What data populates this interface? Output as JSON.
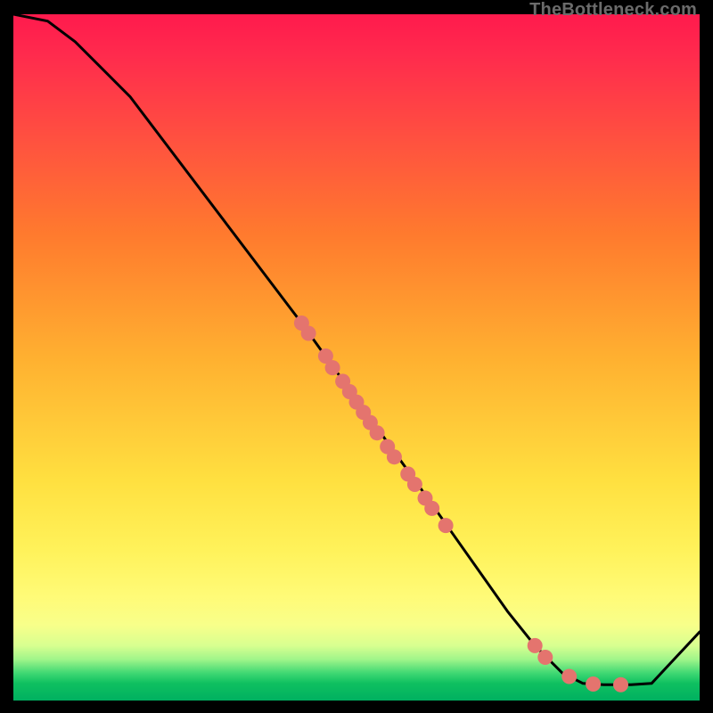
{
  "watermark": "TheBottleneck.com",
  "chart_data": {
    "type": "line",
    "title": "",
    "xlabel": "",
    "ylabel": "",
    "xlim": [
      0,
      100
    ],
    "ylim": [
      0,
      100
    ],
    "grid": false,
    "legend": false,
    "curve": [
      {
        "x": 0,
        "y": 100
      },
      {
        "x": 5,
        "y": 99
      },
      {
        "x": 9,
        "y": 96
      },
      {
        "x": 13,
        "y": 92
      },
      {
        "x": 17,
        "y": 88
      },
      {
        "x": 42,
        "y": 55
      },
      {
        "x": 60,
        "y": 30
      },
      {
        "x": 72,
        "y": 13
      },
      {
        "x": 76,
        "y": 8
      },
      {
        "x": 80,
        "y": 4
      },
      {
        "x": 83,
        "y": 2.5
      },
      {
        "x": 86,
        "y": 2.3
      },
      {
        "x": 90,
        "y": 2.3
      },
      {
        "x": 93,
        "y": 2.5
      },
      {
        "x": 100,
        "y": 10
      }
    ],
    "points": [
      {
        "x": 42,
        "y": 55
      },
      {
        "x": 43,
        "y": 53.5
      },
      {
        "x": 45.5,
        "y": 50.2
      },
      {
        "x": 46.5,
        "y": 48.5
      },
      {
        "x": 48,
        "y": 46.5
      },
      {
        "x": 49,
        "y": 45
      },
      {
        "x": 50,
        "y": 43.5
      },
      {
        "x": 51,
        "y": 42
      },
      {
        "x": 52,
        "y": 40.5
      },
      {
        "x": 53,
        "y": 39
      },
      {
        "x": 54.5,
        "y": 37
      },
      {
        "x": 55.5,
        "y": 35.5
      },
      {
        "x": 57.5,
        "y": 33
      },
      {
        "x": 58.5,
        "y": 31.5
      },
      {
        "x": 60,
        "y": 29.5
      },
      {
        "x": 61,
        "y": 28
      },
      {
        "x": 63,
        "y": 25.5
      },
      {
        "x": 76,
        "y": 8
      },
      {
        "x": 77.5,
        "y": 6.3
      },
      {
        "x": 81,
        "y": 3.5
      },
      {
        "x": 84.5,
        "y": 2.4
      },
      {
        "x": 88.5,
        "y": 2.3
      }
    ],
    "colors": {
      "curve": "#000000",
      "points": "#e4746e",
      "gradient_top": "#ff1a4d",
      "gradient_bottom": "#00b060"
    }
  }
}
